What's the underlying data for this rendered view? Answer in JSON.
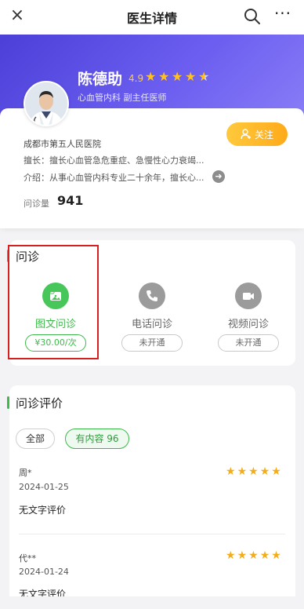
{
  "header": {
    "title": "医生详情",
    "close_icon": "×",
    "more_icon": "···"
  },
  "doctor": {
    "name": "陈德助",
    "rating": "4.9",
    "stars": 4.5,
    "department": "心血管内科 副主任医师",
    "hospital": "成都市第五人民医院",
    "specialty": "擅长：擅长心血管急危重症、急慢性心力衰竭...",
    "intro": "介绍：从事心血管内科专业二十余年，擅长心...",
    "consult_label": "问诊量",
    "consult_count": "941",
    "follow_label": "关注"
  },
  "consultation": {
    "title": "问诊",
    "services": [
      {
        "name": "图文问诊",
        "price": "¥30.00/次",
        "active": true,
        "icon": "image-chat-icon"
      },
      {
        "name": "电话问诊",
        "price": "未开通",
        "active": false,
        "icon": "phone-icon"
      },
      {
        "name": "视频问诊",
        "price": "未开通",
        "active": false,
        "icon": "video-icon"
      }
    ]
  },
  "reviews": {
    "title": "问诊评价",
    "filters": [
      {
        "label": "全部"
      },
      {
        "label": "有内容 96"
      }
    ],
    "items": [
      {
        "user": "周*",
        "date": "2024-01-25",
        "text": "无文字评价",
        "stars": 5
      },
      {
        "user": "代**",
        "date": "2024-01-24",
        "text": "无文字评价",
        "stars": 5
      }
    ]
  },
  "colors": {
    "accent_green": "#3cb94a",
    "hero_purple": "#5a4de6",
    "star_gold": "#ffc120",
    "follow_orange": "#ffb21f",
    "highlight_red": "#d61f1f"
  }
}
